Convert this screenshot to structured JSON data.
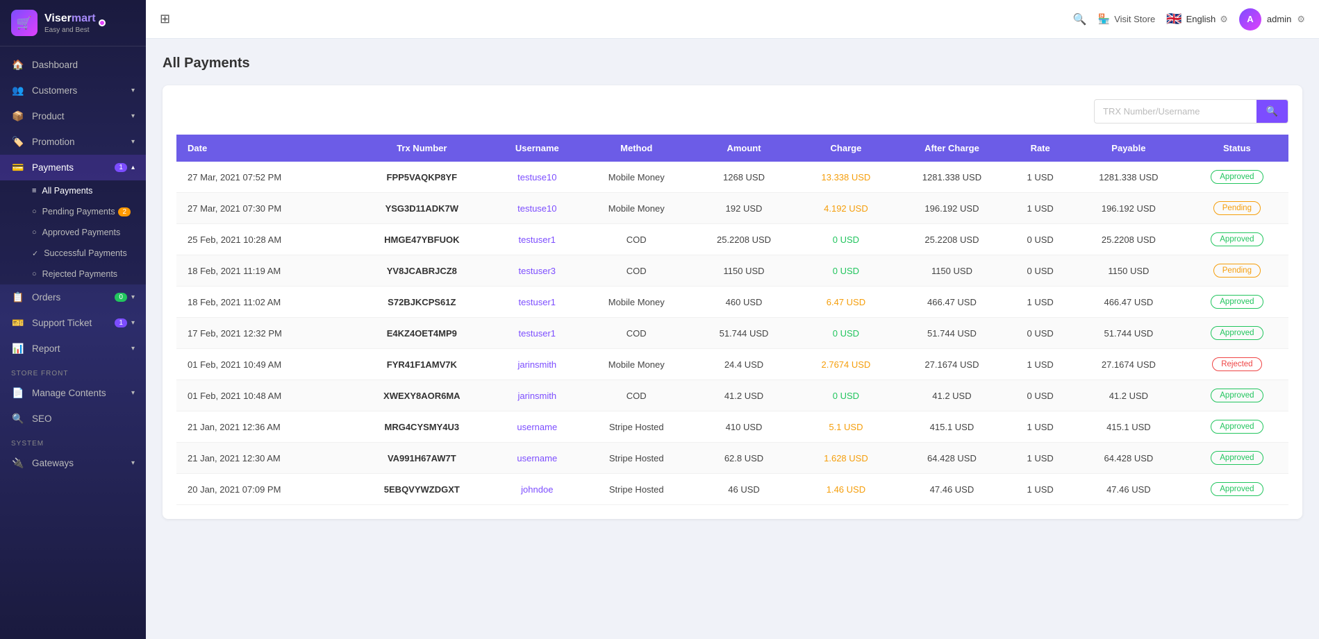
{
  "app": {
    "name_part1": "Viser",
    "name_part2": "mart",
    "tagline": "Easy and Best"
  },
  "header": {
    "visit_store_label": "Visit Store",
    "language": "English",
    "admin_label": "admin",
    "search_placeholder": "TRX Number/Username"
  },
  "sidebar": {
    "nav_items": [
      {
        "id": "dashboard",
        "label": "Dashboard",
        "icon": "🏠",
        "badge": null,
        "has_arrow": false
      },
      {
        "id": "customers",
        "label": "Customers",
        "icon": "👥",
        "badge": null,
        "has_arrow": true
      },
      {
        "id": "product",
        "label": "Product",
        "icon": "📦",
        "badge": null,
        "has_arrow": true
      },
      {
        "id": "promotion",
        "label": "Promotion",
        "icon": "🏷️",
        "badge": null,
        "has_arrow": true
      },
      {
        "id": "payments",
        "label": "Payments",
        "icon": "💳",
        "badge": "1",
        "has_arrow": true
      }
    ],
    "payments_sub": [
      {
        "id": "all-payments",
        "label": "All Payments",
        "icon": "≡",
        "active": true
      },
      {
        "id": "pending-payments",
        "label": "Pending Payments",
        "icon": "○",
        "badge": "2"
      },
      {
        "id": "approved-payments",
        "label": "Approved Payments",
        "icon": "○"
      },
      {
        "id": "successful-payments",
        "label": "Successful Payments",
        "icon": "✓"
      },
      {
        "id": "rejected-payments",
        "label": "Rejected Payments",
        "icon": "○"
      }
    ],
    "more_nav": [
      {
        "id": "orders",
        "label": "Orders",
        "icon": "📋",
        "badge": "0",
        "has_arrow": true
      },
      {
        "id": "support-ticket",
        "label": "Support Ticket",
        "icon": "🎫",
        "badge": "1",
        "has_arrow": true
      },
      {
        "id": "report",
        "label": "Report",
        "icon": "📊",
        "has_arrow": true
      }
    ],
    "store_front_label": "STORE FRONT",
    "store_front_items": [
      {
        "id": "manage-contents",
        "label": "Manage Contents",
        "icon": "📄",
        "has_arrow": true
      },
      {
        "id": "seo",
        "label": "SEO",
        "icon": "🔍",
        "has_arrow": false
      }
    ],
    "system_label": "SYSTEM",
    "system_items": [
      {
        "id": "gateways",
        "label": "Gateways",
        "icon": "🔌",
        "has_arrow": true
      }
    ]
  },
  "page": {
    "title": "All Payments"
  },
  "table": {
    "headers": [
      "Date",
      "Trx Number",
      "Username",
      "Method",
      "Amount",
      "Charge",
      "After Charge",
      "Rate",
      "Payable",
      "Status"
    ],
    "rows": [
      {
        "date": "27 Mar, 2021 07:52 PM",
        "trx": "FPP5VAQKP8YF",
        "username": "testuse10",
        "method": "Mobile Money",
        "amount": "1268 USD",
        "charge": "13.338 USD",
        "after_charge": "1281.338 USD",
        "rate": "1 USD",
        "payable": "1281.338 USD",
        "status": "Approved"
      },
      {
        "date": "27 Mar, 2021 07:30 PM",
        "trx": "YSG3D11ADK7W",
        "username": "testuse10",
        "method": "Mobile Money",
        "amount": "192 USD",
        "charge": "4.192 USD",
        "after_charge": "196.192 USD",
        "rate": "1 USD",
        "payable": "196.192 USD",
        "status": "Pending"
      },
      {
        "date": "25 Feb, 2021 10:28 AM",
        "trx": "HMGE47YBFUOK",
        "username": "testuser1",
        "method": "COD",
        "amount": "25.2208 USD",
        "charge": "0 USD",
        "after_charge": "25.2208 USD",
        "rate": "0 USD",
        "payable": "25.2208 USD",
        "status": "Approved"
      },
      {
        "date": "18 Feb, 2021 11:19 AM",
        "trx": "YV8JCABRJCZ8",
        "username": "testuser3",
        "method": "COD",
        "amount": "1150 USD",
        "charge": "0 USD",
        "after_charge": "1150 USD",
        "rate": "0 USD",
        "payable": "1150 USD",
        "status": "Pending"
      },
      {
        "date": "18 Feb, 2021 11:02 AM",
        "trx": "S72BJKCPS61Z",
        "username": "testuser1",
        "method": "Mobile Money",
        "amount": "460 USD",
        "charge": "6.47 USD",
        "after_charge": "466.47 USD",
        "rate": "1 USD",
        "payable": "466.47 USD",
        "status": "Approved"
      },
      {
        "date": "17 Feb, 2021 12:32 PM",
        "trx": "E4KZ4OET4MP9",
        "username": "testuser1",
        "method": "COD",
        "amount": "51.744 USD",
        "charge": "0 USD",
        "after_charge": "51.744 USD",
        "rate": "0 USD",
        "payable": "51.744 USD",
        "status": "Approved"
      },
      {
        "date": "01 Feb, 2021 10:49 AM",
        "trx": "FYR41F1AMV7K",
        "username": "jarinsmith",
        "method": "Mobile Money",
        "amount": "24.4 USD",
        "charge": "2.7674 USD",
        "after_charge": "27.1674 USD",
        "rate": "1 USD",
        "payable": "27.1674 USD",
        "status": "Rejected"
      },
      {
        "date": "01 Feb, 2021 10:48 AM",
        "trx": "XWEXY8AOR6MA",
        "username": "jarinsmith",
        "method": "COD",
        "amount": "41.2 USD",
        "charge": "0 USD",
        "after_charge": "41.2 USD",
        "rate": "0 USD",
        "payable": "41.2 USD",
        "status": "Approved"
      },
      {
        "date": "21 Jan, 2021 12:36 AM",
        "trx": "MRG4CYSMY4U3",
        "username": "username",
        "method": "Stripe Hosted",
        "amount": "410 USD",
        "charge": "5.1 USD",
        "after_charge": "415.1 USD",
        "rate": "1 USD",
        "payable": "415.1 USD",
        "status": "Approved"
      },
      {
        "date": "21 Jan, 2021 12:30 AM",
        "trx": "VA991H67AW7T",
        "username": "username",
        "method": "Stripe Hosted",
        "amount": "62.8 USD",
        "charge": "1.628 USD",
        "after_charge": "64.428 USD",
        "rate": "1 USD",
        "payable": "64.428 USD",
        "status": "Approved"
      },
      {
        "date": "20 Jan, 2021 07:09 PM",
        "trx": "5EBQVYWZDGXT",
        "username": "johndoe",
        "method": "Stripe Hosted",
        "amount": "46 USD",
        "charge": "1.46 USD",
        "after_charge": "47.46 USD",
        "rate": "1 USD",
        "payable": "47.46 USD",
        "status": "Approved"
      }
    ]
  }
}
